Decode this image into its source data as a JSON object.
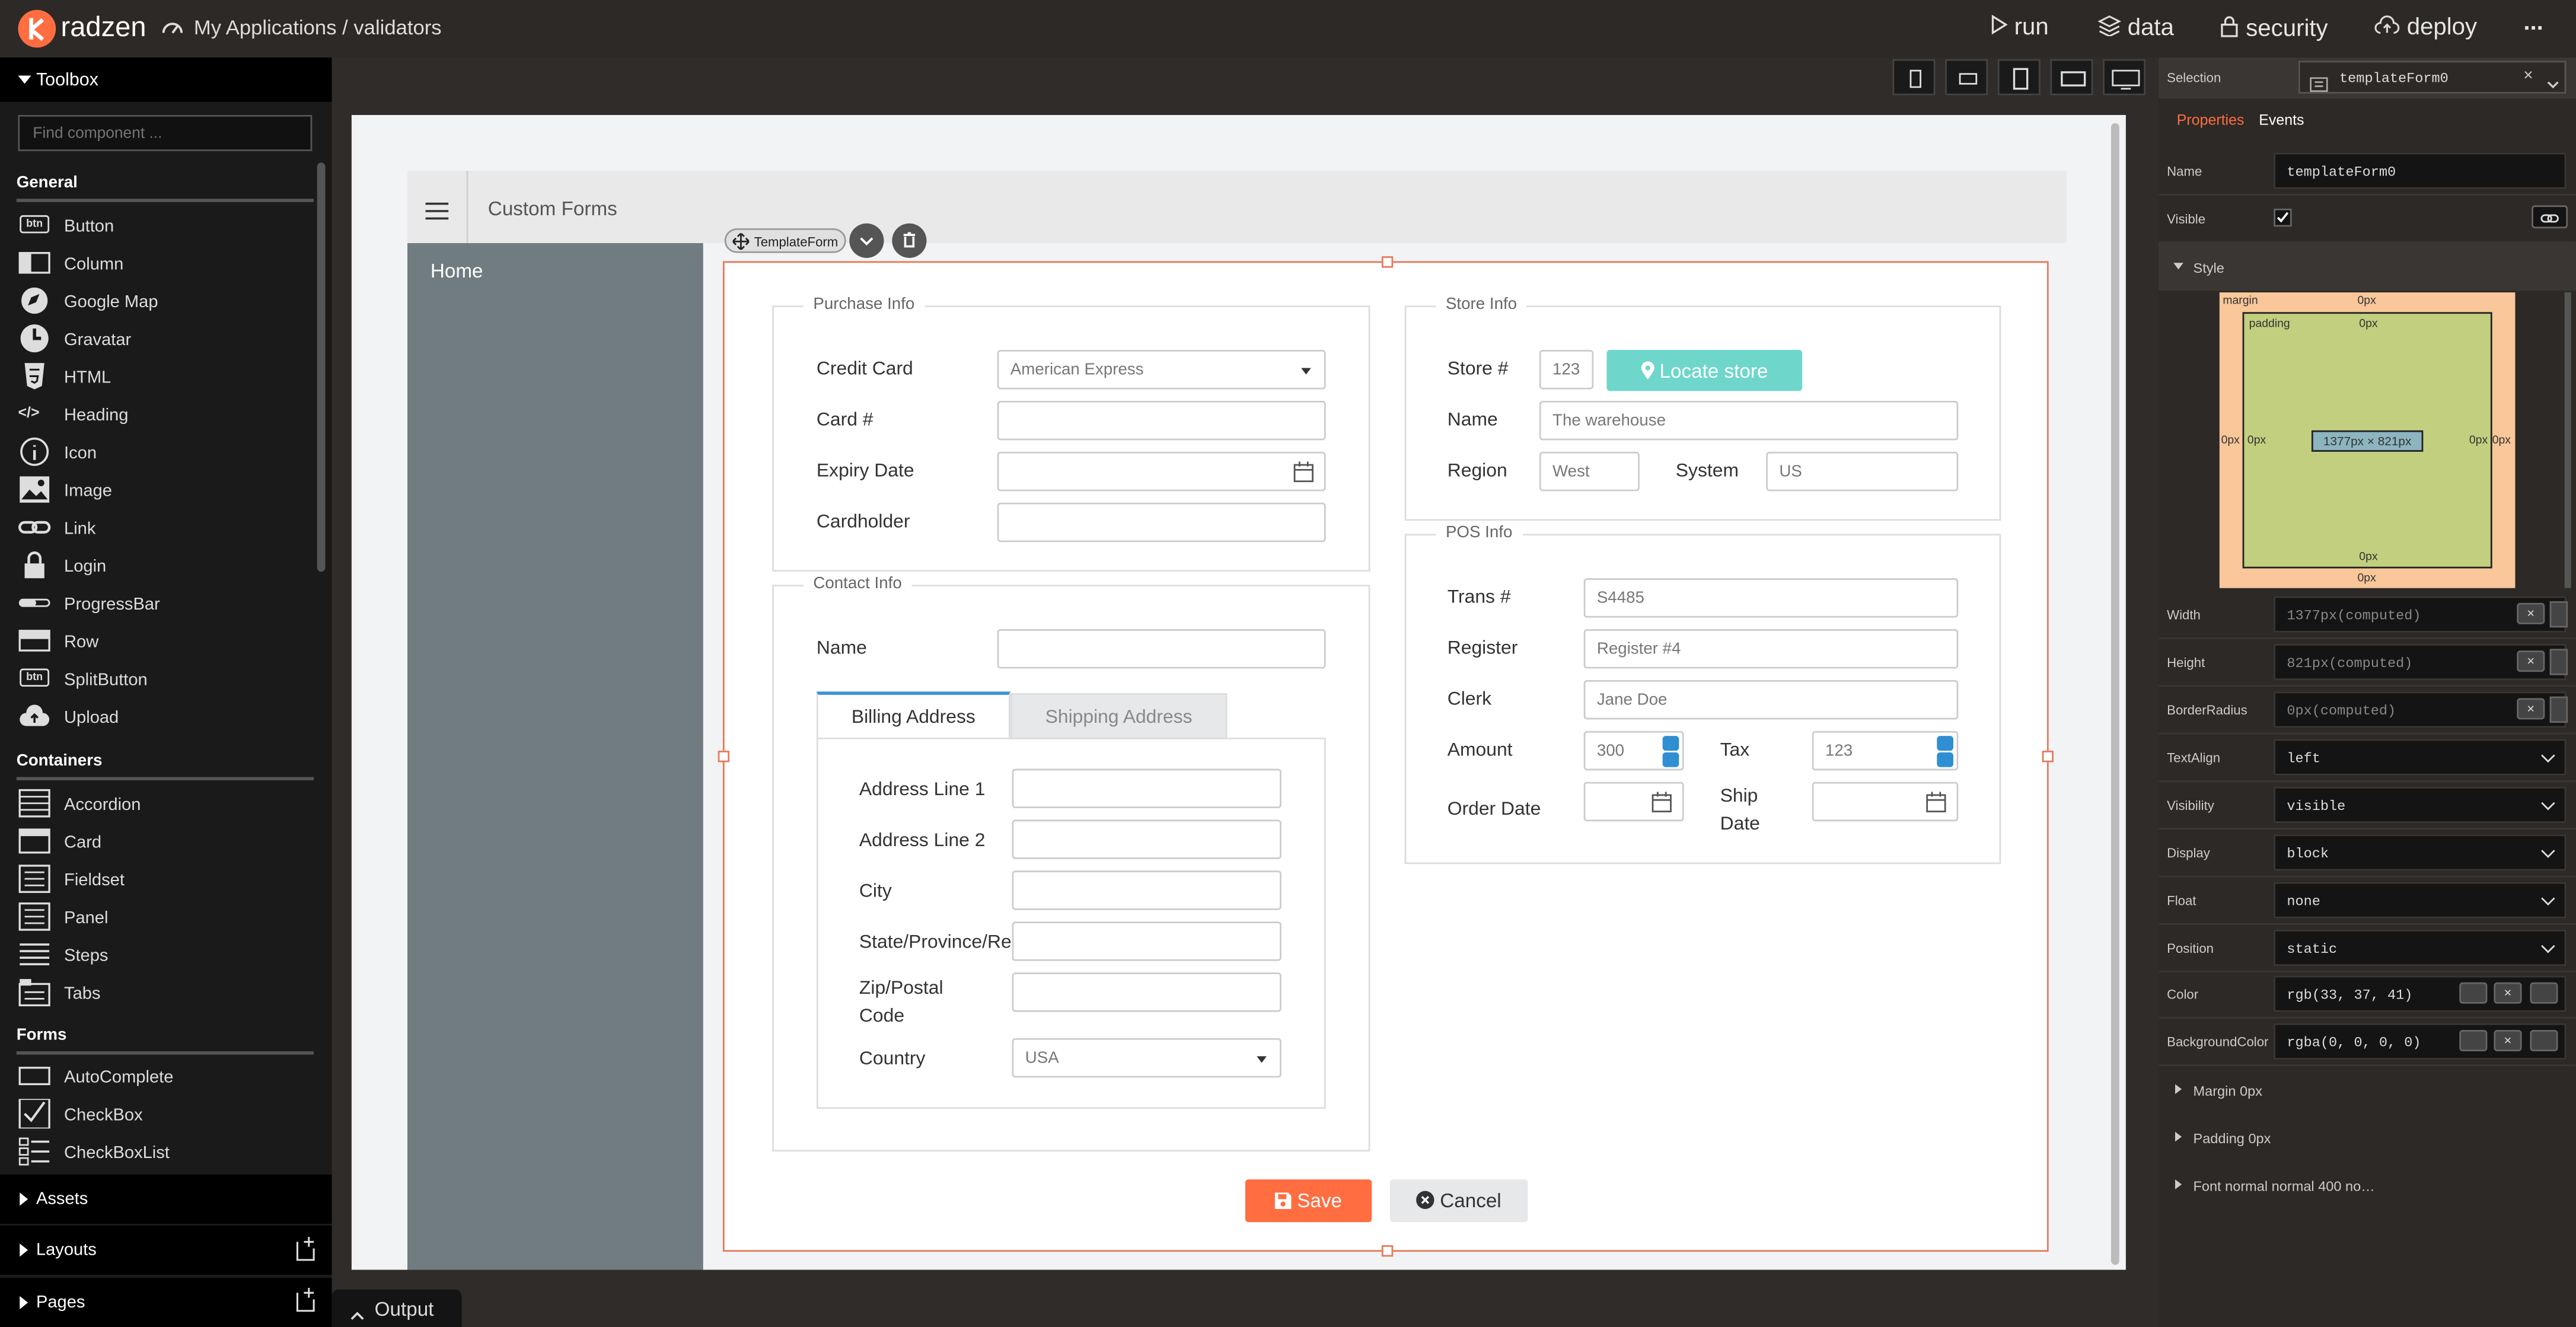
{
  "topbar": {
    "brand": "radzen",
    "breadcrumb": "My Applications / validators",
    "run": "run",
    "data": "data",
    "security": "security",
    "deploy": "deploy",
    "more": "..."
  },
  "toolbox": {
    "title": "Toolbox",
    "search_placeholder": "Find component ...",
    "general_label": "General",
    "general": [
      "Button",
      "Column",
      "Google Map",
      "Gravatar",
      "HTML",
      "Heading",
      "Icon",
      "Image",
      "Link",
      "Login",
      "ProgressBar",
      "Row",
      "SplitButton",
      "Upload"
    ],
    "containers_label": "Containers",
    "containers": [
      "Accordion",
      "Card",
      "Fieldset",
      "Panel",
      "Steps",
      "Tabs"
    ],
    "forms_label": "Forms",
    "forms": [
      "AutoComplete",
      "CheckBox",
      "CheckBoxList"
    ],
    "btn_badge": "btn",
    "html_badge": "</>",
    "assets": "Assets",
    "layouts": "Layouts",
    "pages": "Pages"
  },
  "output_label": "Output",
  "app": {
    "title": "Custom Forms",
    "home": "Home",
    "template_chip": "TemplateForm"
  },
  "purchase": {
    "legend": "Purchase Info",
    "credit_card_label": "Credit Card",
    "credit_card_value": "American Express",
    "card_no_label": "Card #",
    "expiry_label": "Expiry Date",
    "cardholder_label": "Cardholder"
  },
  "contact": {
    "legend": "Contact Info",
    "name_label": "Name",
    "tab_billing": "Billing Address",
    "tab_shipping": "Shipping Address",
    "addr1": "Address Line 1",
    "addr2": "Address Line 2",
    "city": "City",
    "state": "State/Province/Reg",
    "zip": "Zip/Postal Code",
    "country": "Country",
    "country_value": "USA"
  },
  "store": {
    "legend": "Store Info",
    "store_no_label": "Store #",
    "store_no_value": "123",
    "locate_btn": "Locate store",
    "name_label": "Name",
    "name_value": "The warehouse",
    "region_label": "Region",
    "region_value": "West",
    "system_label": "System",
    "system_value": "US"
  },
  "pos": {
    "legend": "POS Info",
    "trans_label": "Trans #",
    "trans_value": "S4485",
    "register_label": "Register",
    "register_value": "Register #4",
    "clerk_label": "Clerk",
    "clerk_value": "Jane Doe",
    "amount_label": "Amount",
    "amount_value": "300",
    "tax_label": "Tax",
    "tax_value": "123",
    "order_date_label": "Order Date",
    "ship_date_label": "Ship Date"
  },
  "buttons": {
    "save": "Save",
    "cancel": "Cancel"
  },
  "props": {
    "selection_label": "Selection",
    "selection_value": "templateForm0",
    "tab_properties": "Properties",
    "tab_events": "Events",
    "name_label": "Name",
    "name_value": "templateForm0",
    "visible_label": "Visible",
    "style_label": "Style",
    "box": {
      "margin": "margin",
      "padding": "padding",
      "zero": "0px",
      "size": "1377px × 821px"
    },
    "rows": [
      {
        "label": "Width",
        "value": "1377px(computed)"
      },
      {
        "label": "Height",
        "value": "821px(computed)"
      },
      {
        "label": "BorderRadius",
        "value": "0px(computed)"
      },
      {
        "label": "TextAlign",
        "value": "left"
      },
      {
        "label": "Visibility",
        "value": "visible"
      },
      {
        "label": "Display",
        "value": "block"
      },
      {
        "label": "Float",
        "value": "none"
      },
      {
        "label": "Position",
        "value": "static"
      },
      {
        "label": "Color",
        "value": "rgb(33, 37, 41)"
      },
      {
        "label": "BackgroundColor",
        "value": "rgba(0, 0, 0, 0)"
      }
    ],
    "margin_section": "Margin 0px",
    "padding_section": "Padding 0px",
    "font_section": "Font normal normal 400 no…"
  },
  "colors": {
    "accent": "#ff6d41",
    "teal": "#6fd6cb",
    "topbar": "#2c2926"
  }
}
